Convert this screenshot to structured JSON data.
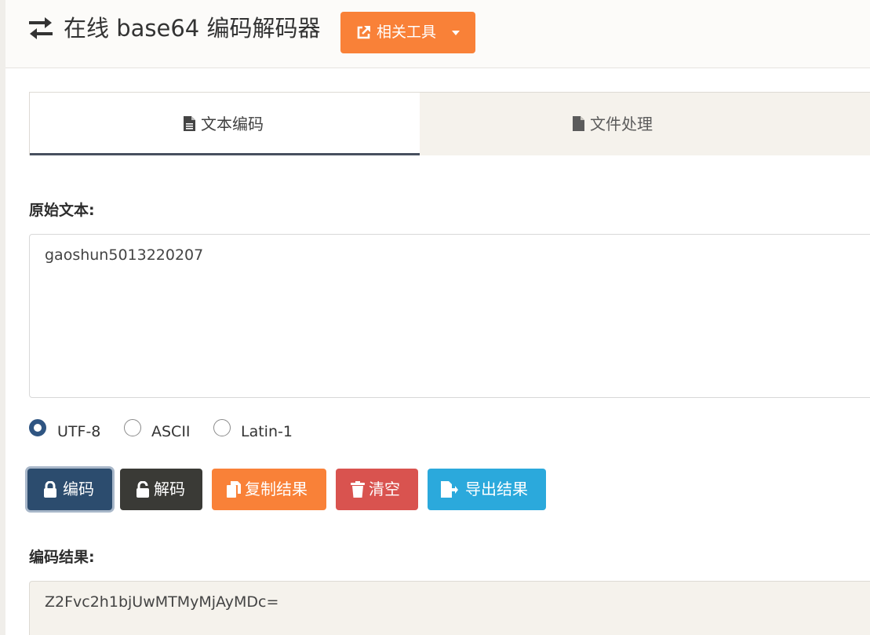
{
  "header": {
    "title": "在线 base64 编码解码器",
    "tools_button_label": "相关工具"
  },
  "tabs": [
    {
      "label": "文本编码",
      "active": true
    },
    {
      "label": "文件处理",
      "active": false
    }
  ],
  "input": {
    "label": "原始文本:",
    "value": "gaoshun5013220207"
  },
  "encoding_options": [
    {
      "label": "UTF-8",
      "checked": true
    },
    {
      "label": "ASCII",
      "checked": false
    },
    {
      "label": "Latin-1",
      "checked": false
    }
  ],
  "actions": {
    "encode": "编码",
    "decode": "解码",
    "copy": "复制结果",
    "clear": "清空",
    "export": "导出结果"
  },
  "output": {
    "label": "编码结果:",
    "value": "Z2Fvc2h1bjUwMTMyMjAyMDc="
  },
  "colors": {
    "accent_orange": "#f98138",
    "encode_blue": "#2c4c6e",
    "decode_dark": "#3a3a36",
    "clear_red": "#d9534f",
    "export_cyan": "#2ba9dc"
  },
  "icons": {
    "title": "exchange-arrows-icon",
    "tools": "external-link-icon",
    "tab_text": "file-text-icon",
    "tab_file": "file-icon",
    "encode": "lock-icon",
    "decode": "unlock-icon",
    "copy": "copy-icon",
    "clear": "trash-icon",
    "export": "file-export-icon"
  }
}
